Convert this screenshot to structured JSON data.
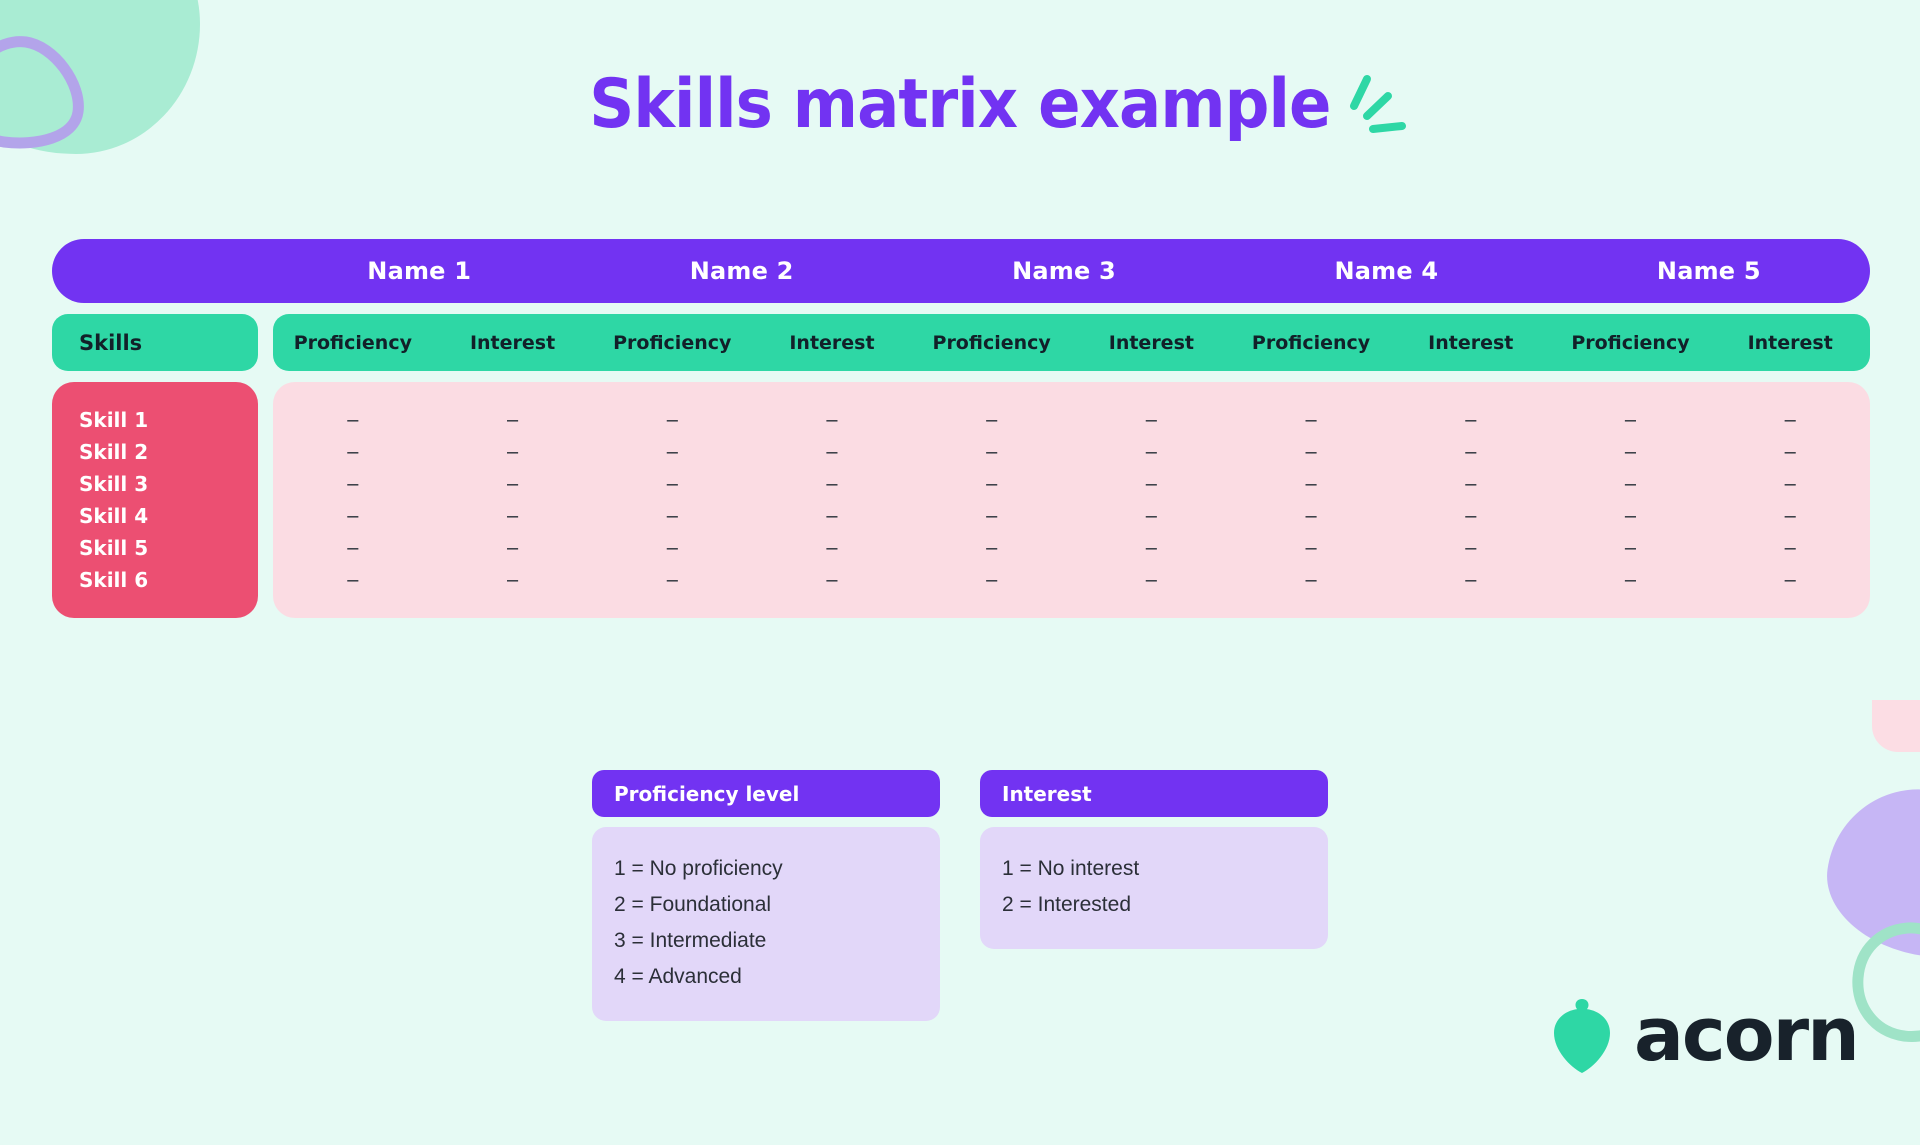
{
  "page": {
    "title": "Skills matrix example",
    "background_color": "#e6faf4"
  },
  "colors": {
    "purple": "#7233f2",
    "green": "#2ed7a5",
    "rose": "#ec4f72",
    "pink_panel": "#fbdce3",
    "lavender": "#e2d7f9",
    "mint": "#a9ecd3",
    "dark_text": "#18222b"
  },
  "matrix": {
    "people": [
      "Name 1",
      "Name 2",
      "Name 3",
      "Name 4",
      "Name 5"
    ],
    "skills_header": "Skills",
    "sub_headers": [
      "Proficiency",
      "Interest"
    ],
    "skills": [
      "Skill 1",
      "Skill 2",
      "Skill 3",
      "Skill 4",
      "Skill 5",
      "Skill 6"
    ],
    "empty_cell": "–",
    "rows": [
      {
        "skill": "Skill 1",
        "cells": [
          "–",
          "–",
          "–",
          "–",
          "–",
          "–",
          "–",
          "–",
          "–",
          "–"
        ]
      },
      {
        "skill": "Skill 2",
        "cells": [
          "–",
          "–",
          "–",
          "–",
          "–",
          "–",
          "–",
          "–",
          "–",
          "–"
        ]
      },
      {
        "skill": "Skill 3",
        "cells": [
          "–",
          "–",
          "–",
          "–",
          "–",
          "–",
          "–",
          "–",
          "–",
          "–"
        ]
      },
      {
        "skill": "Skill 4",
        "cells": [
          "–",
          "–",
          "–",
          "–",
          "–",
          "–",
          "–",
          "–",
          "–",
          "–"
        ]
      },
      {
        "skill": "Skill 5",
        "cells": [
          "–",
          "–",
          "–",
          "–",
          "–",
          "–",
          "–",
          "–",
          "–",
          "–"
        ]
      },
      {
        "skill": "Skill 6",
        "cells": [
          "–",
          "–",
          "–",
          "–",
          "–",
          "–",
          "–",
          "–",
          "–",
          "–"
        ]
      }
    ]
  },
  "legends": [
    {
      "id": "proficiency",
      "title": "Proficiency level",
      "items": [
        "1 = No proficiency",
        "2 = Foundational",
        "3 = Intermediate",
        "4 = Advanced"
      ]
    },
    {
      "id": "interest",
      "title": "Interest",
      "items": [
        "1 = No interest",
        "2 = Interested"
      ]
    }
  ],
  "logo": {
    "wordmark": "acorn",
    "icon": "acorn-icon"
  }
}
